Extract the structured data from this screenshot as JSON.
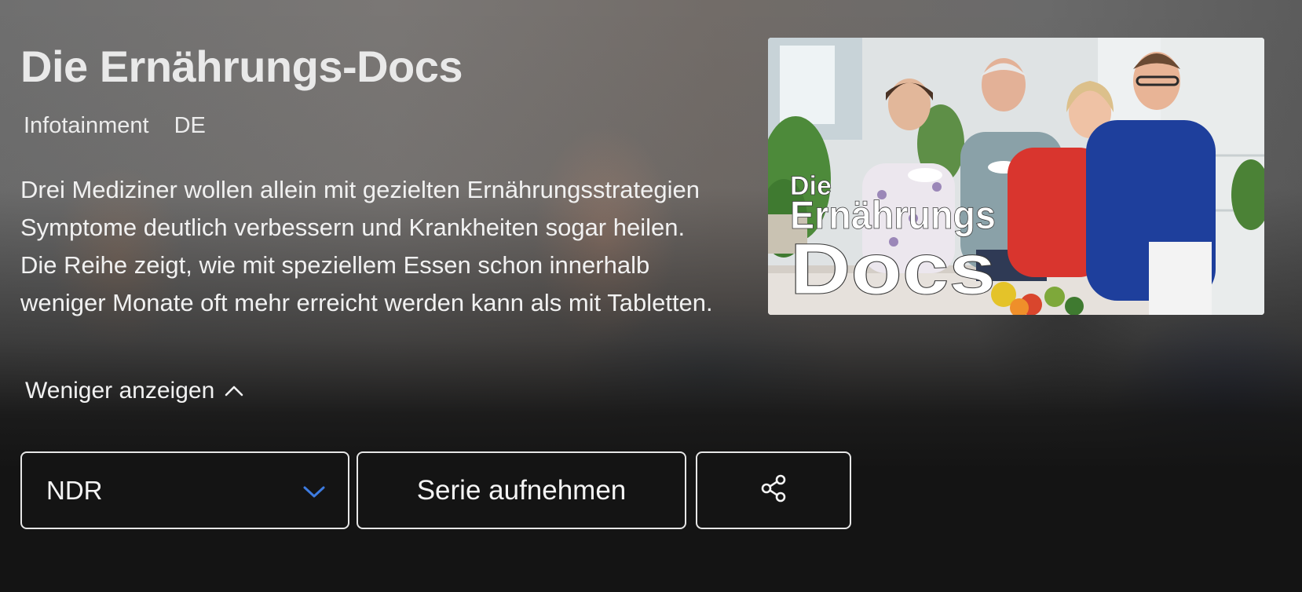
{
  "show": {
    "title": "Die Ernährungs-Docs",
    "genre": "Infotainment",
    "country": "DE",
    "description": "Drei Mediziner wollen allein mit gezielten Ernährungsstrategien Symptome deutlich verbessern und Krankheiten sogar heilen. Die Reihe zeigt, wie mit speziellem Essen schon innerhalb weniger Monate oft mehr erreicht werden kann als mit Tabletten.",
    "toggle_label": "Weniger anzeigen"
  },
  "cover": {
    "logo_line1": "Die",
    "logo_line2": "Ernährungs",
    "logo_line3": "Docs"
  },
  "actions": {
    "channel_select": {
      "value": "NDR",
      "icon": "chevron-down-icon",
      "accent": "#3d7be0"
    },
    "record_label": "Serie aufnehmen",
    "share_icon": "share-icon"
  }
}
